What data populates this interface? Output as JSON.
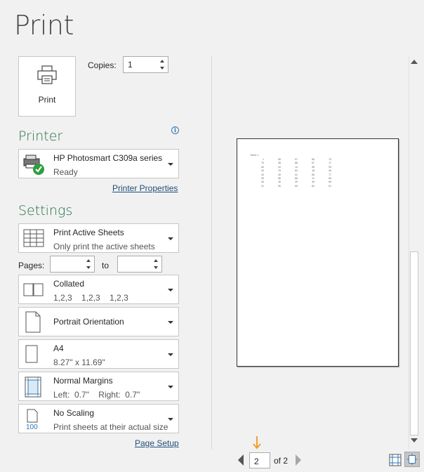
{
  "title": "Print",
  "print_button": {
    "label": "Print"
  },
  "copies": {
    "label": "Copies:",
    "value": "1"
  },
  "printer": {
    "heading": "Printer",
    "name": "HP Photosmart C309a series",
    "status": "Ready",
    "properties_link": "Printer Properties"
  },
  "settings": {
    "heading": "Settings",
    "print_what": {
      "title": "Print Active Sheets",
      "subtitle": "Only print the active sheets"
    },
    "pages": {
      "label": "Pages:",
      "from": "",
      "to_label": "to",
      "to": ""
    },
    "collation": {
      "title": "Collated",
      "subtitle": "1,2,3    1,2,3    1,2,3"
    },
    "orientation": {
      "title": "Portrait Orientation"
    },
    "paper": {
      "title": "A4",
      "subtitle": "8.27\" x 11.69\""
    },
    "margins": {
      "title": "Normal Margins",
      "subtitle": "Left:  0.7\"    Right:  0.7\""
    },
    "scaling": {
      "title": "No Scaling",
      "subtitle": "Print sheets at their actual size",
      "icon_text": "100"
    },
    "page_setup_link": "Page Setup"
  },
  "preview": {
    "sheet_title": "Table 1",
    "rows": [
      [
        "1",
        "55",
        "97",
        "66",
        "70"
      ],
      [
        "79",
        "48",
        "88",
        "67",
        "17"
      ],
      [
        "60",
        "44",
        "14",
        "98",
        "99"
      ],
      [
        "94",
        "75",
        "63",
        "18",
        "46"
      ],
      [
        "40",
        "49",
        "41",
        "66",
        "77"
      ],
      [
        "90",
        "66",
        "86",
        "11",
        "83"
      ],
      [
        "26",
        "16",
        "29",
        "46",
        "65"
      ],
      [
        "41",
        "96",
        "69",
        "60",
        "61"
      ]
    ]
  },
  "navigation": {
    "current_page": "2",
    "total": "of 2"
  },
  "colors": {
    "accent": "#217346",
    "link": "#1f4e79",
    "annotation_arrow": "#f0a030"
  }
}
